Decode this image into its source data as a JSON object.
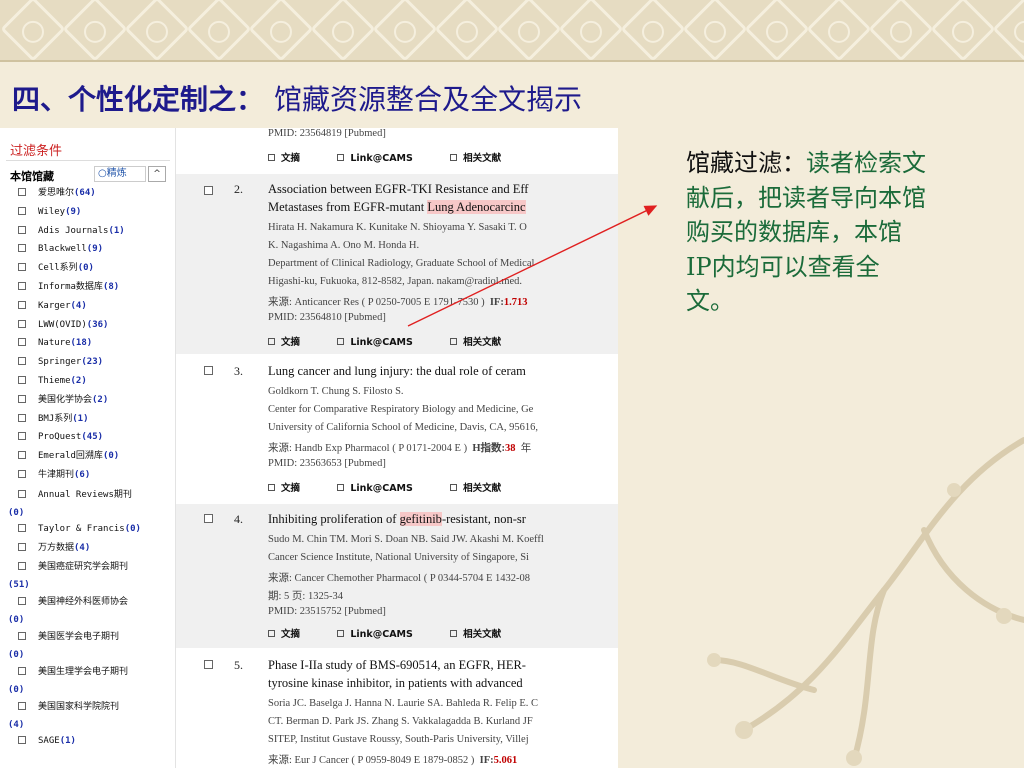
{
  "slide": {
    "title": "四、个性化定制之：",
    "subtitle": "馆藏资源整合及全文揭示"
  },
  "callout": {
    "lead": "馆藏过滤：",
    "body": "读者检索文献后，把读者导向本馆购买的数据库，本馆IP内均可以查看全文。"
  },
  "sidebar": {
    "filter_title": "过滤条件",
    "library_label": "本馆馆藏",
    "refine_label": "精炼",
    "collapse_label": "^",
    "items": [
      {
        "label": "爱思唯尔",
        "count": "(64)"
      },
      {
        "label": "Wiley",
        "count": "(9)"
      },
      {
        "label": "Adis Journals",
        "count": "(1)"
      },
      {
        "label": "Blackwell",
        "count": "(9)"
      },
      {
        "label": "Cell系列",
        "count": "(0)"
      },
      {
        "label": "Informa数据库",
        "count": "(8)"
      },
      {
        "label": "Karger",
        "count": "(4)"
      },
      {
        "label": "LWW(OVID)",
        "count": "(36)"
      },
      {
        "label": "Nature",
        "count": "(18)"
      },
      {
        "label": "Springer",
        "count": "(23)"
      },
      {
        "label": "Thieme",
        "count": "(2)"
      },
      {
        "label": "美国化学协会",
        "count": "(2)"
      },
      {
        "label": "BMJ系列",
        "count": "(1)"
      },
      {
        "label": "ProQuest",
        "count": "(45)"
      },
      {
        "label": "Emerald回溯库",
        "count": "(0)"
      },
      {
        "label": "牛津期刊",
        "count": "(6)"
      },
      {
        "label": "Annual Reviews期刊",
        "count": "(0)"
      },
      {
        "label": "Taylor & Francis",
        "count": "(0)"
      },
      {
        "label": "万方数据",
        "count": "(4)"
      },
      {
        "label": "美国癌症研究学会期刊",
        "count": "(51)"
      },
      {
        "label": "美国神经外科医师协会",
        "count": "(0)"
      },
      {
        "label": "美国医学会电子期刊",
        "count": "(0)"
      },
      {
        "label": "美国生理学会电子期刊",
        "count": "(0)"
      },
      {
        "label": "美国国家科学院院刊",
        "count": "(4)"
      },
      {
        "label": "SAGE",
        "count": "(1)"
      }
    ]
  },
  "links": {
    "abstract": "文摘",
    "link": "Link@CAMS",
    "related": "相关文献"
  },
  "records": [
    {
      "pmid": "PMID: 23564819 [Pubmed]"
    },
    {
      "num": "2.",
      "title_pre": "Association between EGFR-TKI Resistance and Eff",
      "title_line2_pre": "Metastases from EGFR-mutant ",
      "title_hl": "Lung Adenocarcinc",
      "authors1": "Hirata H. Nakamura K. Kunitake N. Shioyama Y. Sasaki T. O",
      "authors2": "K. Nagashima A. Ono M. Honda H.",
      "affil1": "Department of Clinical Radiology, Graduate School of Medical",
      "affil2": "Higashi-ku, Fukuoka, 812-8582, Japan. nakam@radiol.med.",
      "source": "来源: Anticancer Res ( P 0250-7005 E 1791-7530 )",
      "if_label": "IF:",
      "if_value": "1.713",
      "pmid": "PMID: 23564810 [Pubmed]"
    },
    {
      "num": "3.",
      "title": "Lung cancer and lung injury: the dual role of ceram",
      "authors1": "Goldkorn T. Chung S. Filosto S.",
      "affil1": "Center for Comparative Respiratory Biology and Medicine, Ge",
      "affil2": "University of California School of Medicine, Davis, CA, 95616,",
      "source": "来源: Handb Exp Pharmacol ( P 0171-2004 E )",
      "if_label": "H指数:",
      "if_value": "38",
      "year_label": "年",
      "pmid": "PMID: 23563653 [Pubmed]"
    },
    {
      "num": "4.",
      "title_pre": "Inhibiting proliferation of ",
      "title_hl": "gefitinib",
      "title_post": "-resistant, non-sr",
      "authors1": "Sudo M. Chin TM. Mori S. Doan NB. Said JW. Akashi M. Koeffl",
      "affil1": "Cancer Science Institute, National University of Singapore, Si",
      "source": "来源: Cancer Chemother Pharmacol ( P 0344-5704 E 1432-08",
      "issue": "期: 5 页: 1325-34",
      "pmid": "PMID: 23515752 [Pubmed]"
    },
    {
      "num": "5.",
      "title": "Phase I-IIa study of BMS-690514, an EGFR, HER-",
      "title_line2": "tyrosine kinase inhibitor, in patients with advanced",
      "authors1": "Soria JC. Baselga J. Hanna N. Laurie SA. Bahleda R. Felip E. C",
      "authors2": "CT. Berman D. Park JS. Zhang S. Vakkalagadda B. Kurland JF",
      "affil1": "SITEP, Institut Gustave Roussy, South-Paris University, Villej",
      "source": "来源: Eur J Cancer ( P 0959-8049 E 1879-0852 )",
      "if_label": "IF:",
      "if_value": "5.061"
    }
  ],
  "colors": {
    "title": "#1e1a8c",
    "callout_text": "#1b6b3a",
    "highlight": "#f7c8c8",
    "impact": "#c00000",
    "arrow": "#e02020"
  }
}
